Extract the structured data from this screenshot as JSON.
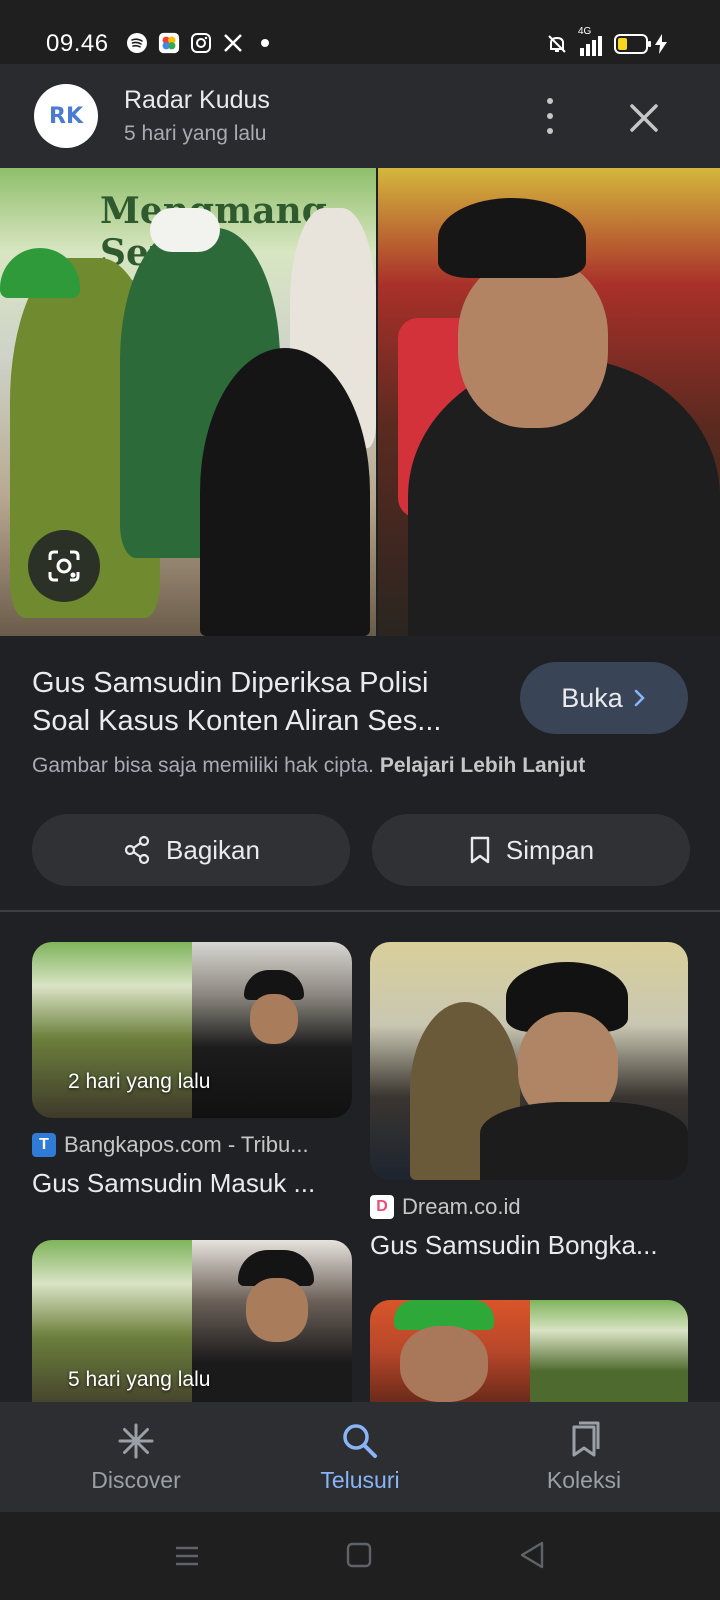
{
  "status_bar": {
    "time": "09.46",
    "network": "4G"
  },
  "header": {
    "source_name": "Radar Kudus",
    "source_time": "5 hari yang lalu",
    "logo_text": "RK"
  },
  "hero": {
    "banner_text": "Mengmang Sengla Macan"
  },
  "detail": {
    "title": "Gus Samsudin Diperiksa Polisi Soal Kasus Konten Aliran Ses...",
    "open_label": "Buka",
    "copyright_text": "Gambar bisa saja memiliki hak cipta.",
    "learn_more": "Pelajari Lebih Lanjut",
    "share_label": "Bagikan",
    "save_label": "Simpan"
  },
  "results": [
    {
      "badge": "2 hari yang lalu",
      "site": "Bangkapos.com - Tribu...",
      "favicon": "T",
      "title": "Gus Samsudin Masuk ..."
    },
    {
      "badge": "",
      "site": "Dream.co.id",
      "favicon": "D",
      "title": "Gus Samsudin Bongka..."
    },
    {
      "badge": "5 hari yang lalu",
      "site": "",
      "favicon": "",
      "title": ""
    },
    {
      "badge": "",
      "site": "",
      "favicon": "",
      "title": ""
    }
  ],
  "bottom_nav": {
    "items": [
      {
        "label": "Discover",
        "icon": "asterisk-icon"
      },
      {
        "label": "Telusuri",
        "icon": "search-icon"
      },
      {
        "label": "Koleksi",
        "icon": "collections-icon"
      }
    ],
    "active": "Telusuri"
  },
  "colors": {
    "accent": "#8ab4f8",
    "background": "#202124",
    "button_bg": "#303134",
    "open_button_bg": "#394457"
  }
}
